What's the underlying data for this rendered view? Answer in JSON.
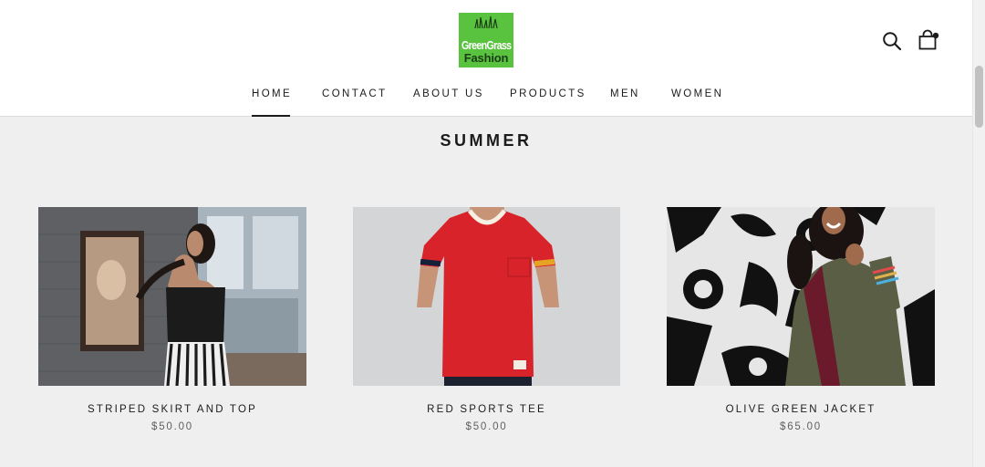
{
  "brand": {
    "logo_line1": "GreenGrass",
    "logo_line2": "Fashion",
    "logo_color": "#59c23e"
  },
  "header": {
    "search_icon": "search-icon",
    "cart_icon": "shopping-bag-icon",
    "cart_has_items": true
  },
  "nav": {
    "items": [
      {
        "label": "HOME",
        "active": true
      },
      {
        "label": "CONTACT",
        "active": false
      },
      {
        "label": "ABOUT US",
        "active": false
      },
      {
        "label": "PRODUCTS",
        "active": false
      },
      {
        "label": "MEN",
        "active": false
      },
      {
        "label": "WOMEN",
        "active": false
      }
    ]
  },
  "collection": {
    "title": "SUMMER",
    "products": [
      {
        "name": "STRIPED SKIRT AND TOP",
        "price": "$50.00",
        "image": "woman-black-top-striped-skirt-photo"
      },
      {
        "name": "RED SPORTS TEE",
        "price": "$50.00",
        "image": "red-tshirt-photo"
      },
      {
        "name": "OLIVE GREEN JACKET",
        "price": "$65.00",
        "image": "woman-olive-jacket-graffiti-photo"
      }
    ]
  },
  "colors": {
    "text": "#1c1b1b",
    "price": "#5f5f5f",
    "background": "#efefef",
    "header_bg": "#ffffff"
  }
}
